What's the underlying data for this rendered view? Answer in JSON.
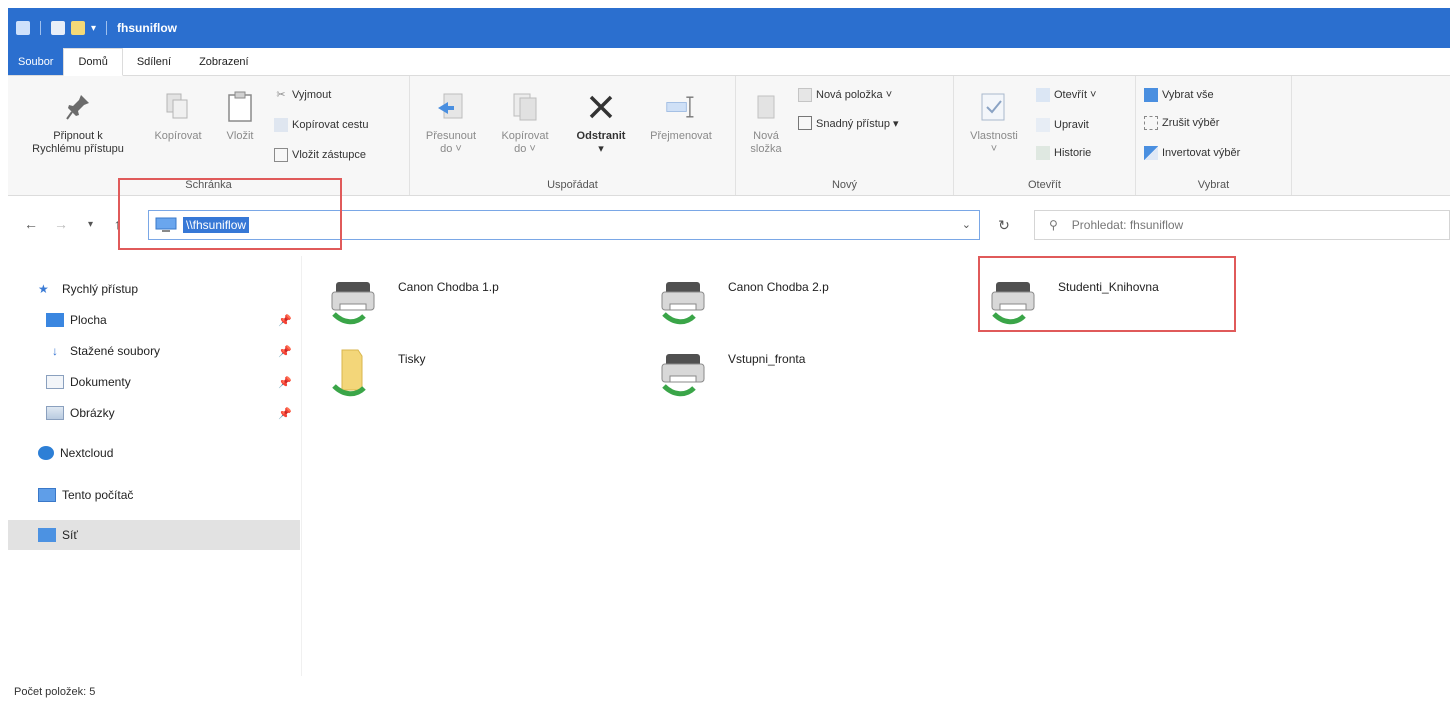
{
  "window": {
    "title": "fhsuniflow"
  },
  "ribbon_tabs": [
    "Soubor",
    "Domů",
    "Sdílení",
    "Zobrazení"
  ],
  "ribbon": {
    "clipboard": {
      "pin_label_1": "Připnout k",
      "pin_label_2": "Rychlému přístupu",
      "copy": "Kopírovat",
      "paste": "Vložit",
      "cut": "Vyjmout",
      "copy_path": "Kopírovat cestu",
      "paste_shortcut": "Vložit zástupce",
      "label": "Schránka"
    },
    "organize": {
      "move_to_1": "Přesunout",
      "move_to_2": "do ˅",
      "copy_to_1": "Kopírovat",
      "copy_to_2": "do ˅",
      "delete_1": "Odstranit",
      "delete_2": "▾",
      "rename": "Přejmenovat",
      "label": "Uspořádat"
    },
    "new": {
      "new_folder_1": "Nová",
      "new_folder_2": "složka",
      "new_item": "Nová položka ˅",
      "easy_access": "Snadný přístup ▾",
      "label": "Nový"
    },
    "open": {
      "properties_1": "Vlastnosti",
      "properties_2": "˅",
      "open": "Otevřít ˅",
      "edit": "Upravit",
      "history": "Historie",
      "label": "Otevřít"
    },
    "select": {
      "select_all": "Vybrat vše",
      "select_none": "Zrušit výběr",
      "invert": "Invertovat výběr",
      "label": "Vybrat"
    }
  },
  "address": {
    "path": "\\\\fhsuniflow"
  },
  "search": {
    "placeholder": "Prohledat: fhsuniflow"
  },
  "sidebar": {
    "quick_access": "Rychlý přístup",
    "desktop": "Plocha",
    "downloads": "Stažené soubory",
    "documents": "Dokumenty",
    "pictures": "Obrázky",
    "nextcloud": "Nextcloud",
    "this_pc": "Tento počítač",
    "network": "Síť"
  },
  "items": [
    {
      "name": "Canon Chodba 1.p",
      "type": "printer"
    },
    {
      "name": "Canon Chodba 2.p",
      "type": "printer"
    },
    {
      "name": "Studenti_Knihovna",
      "type": "printer"
    },
    {
      "name": "Tisky",
      "type": "folder"
    },
    {
      "name": "Vstupni_fronta",
      "type": "printer"
    }
  ],
  "status": {
    "count": "Počet položek: 5"
  },
  "colors": {
    "accent": "#2b6fcf",
    "highlight_box": "#e05a5a",
    "selected_nav": "#e2e2e2"
  }
}
